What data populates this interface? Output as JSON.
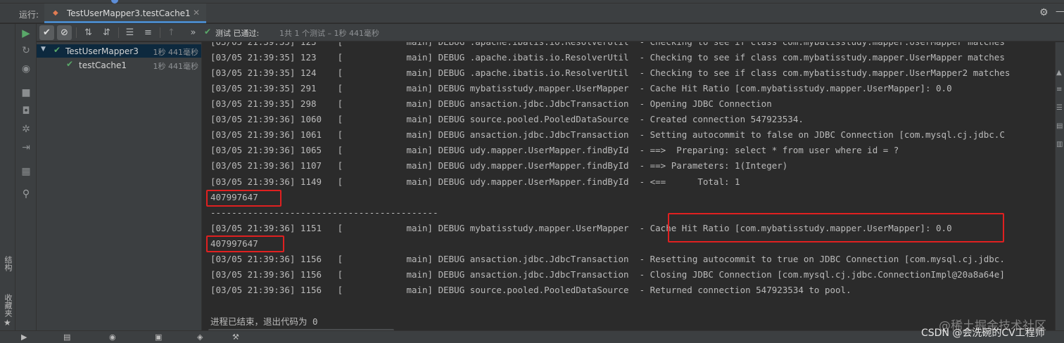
{
  "run_header": {
    "label": "运行:",
    "tab_title": "TestUserMapper3.testCache1",
    "tab_close": "✕",
    "gear_icon": "gear-icon",
    "minimize": "—"
  },
  "test_toolbar": {
    "status_main": "测试 已通过:",
    "status_detail": "1共 1 个测试 – 1秒 441毫秒"
  },
  "test_tree": [
    {
      "name": "TestUserMapper3",
      "time": "1秒 441毫秒",
      "selected": true
    },
    {
      "name": "testCache1",
      "time": "1秒 441毫秒",
      "selected": false
    }
  ],
  "console_lines": [
    "[03/05 21:39:35] 123    [            main] DEBUG .apache.ibatis.io.ResolverUtil  - Checking to see if class com.mybatisstudy.mapper.UserMapper matches",
    "[03/05 21:39:35] 124    [            main] DEBUG .apache.ibatis.io.ResolverUtil  - Checking to see if class com.mybatisstudy.mapper.UserMapper2 matches",
    "[03/05 21:39:35] 291    [            main] DEBUG mybatisstudy.mapper.UserMapper  - Cache Hit Ratio [com.mybatisstudy.mapper.UserMapper]: 0.0",
    "[03/05 21:39:35] 298    [            main] DEBUG ansaction.jdbc.JdbcTransaction  - Opening JDBC Connection",
    "[03/05 21:39:36] 1060   [            main] DEBUG source.pooled.PooledDataSource  - Created connection 547923534.",
    "[03/05 21:39:36] 1061   [            main] DEBUG ansaction.jdbc.JdbcTransaction  - Setting autocommit to false on JDBC Connection [com.mysql.cj.jdbc.C",
    "[03/05 21:39:36] 1065   [            main] DEBUG udy.mapper.UserMapper.findById  - ==>  Preparing: select * from user where id = ?",
    "[03/05 21:39:36] 1107   [            main] DEBUG udy.mapper.UserMapper.findById  - ==> Parameters: 1(Integer)",
    "[03/05 21:39:36] 1149   [            main] DEBUG udy.mapper.UserMapper.findById  - <==      Total: 1",
    "407997647",
    "-------------------------------------------",
    "[03/05 21:39:36] 1151   [            main] DEBUG mybatisstudy.mapper.UserMapper  - Cache Hit Ratio [com.mybatisstudy.mapper.UserMapper]: 0.0",
    "407997647",
    "[03/05 21:39:36] 1156   [            main] DEBUG ansaction.jdbc.JdbcTransaction  - Resetting autocommit to true on JDBC Connection [com.mysql.cj.jdbc.",
    "[03/05 21:39:36] 1156   [            main] DEBUG ansaction.jdbc.JdbcTransaction  - Closing JDBC Connection [com.mysql.cj.jdbc.ConnectionImpl@20a8a64e]",
    "[03/05 21:39:36] 1156   [            main] DEBUG source.pooled.PooledDataSource  - Returned connection 547923534 to pool.",
    "",
    "进程已结束，退出代码为 0"
  ],
  "left_strip": {
    "structure_label": "结构",
    "favorites_label": "收藏夹"
  },
  "watermarks": {
    "juejin": "@稀土掘金技术社区",
    "csdn": "CSDN @会洗碗的CV工程师"
  },
  "colors": {
    "accent": "#4a88c7",
    "pass_green": "#59a869",
    "highlight_red": "#e02020",
    "console_bg": "#2b2b2b",
    "panel_bg": "#3c3f41"
  }
}
